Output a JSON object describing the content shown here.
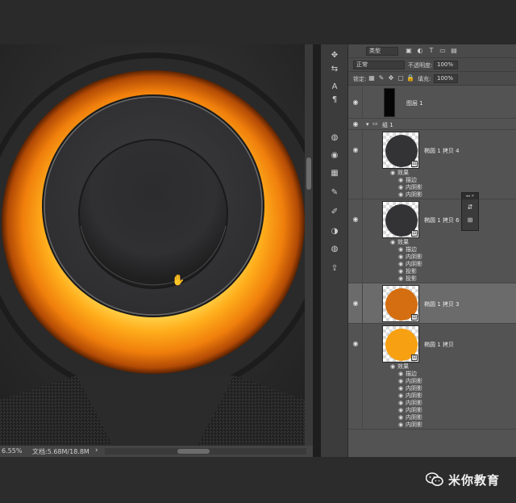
{
  "status": {
    "zoom": "6.55%",
    "doc": "文档:5.68M/18.8M",
    "arrow": "›"
  },
  "toolstrip": {
    "icons": [
      "move-icon",
      "adjust-icon",
      "type-icon",
      "paragraph-icon",
      "swatch-icon",
      "color-icon",
      "style-icon",
      "brush-icon",
      "clone-icon",
      "circle-half-icon",
      "mask-icon",
      "export-icon"
    ],
    "glyphs": [
      "✥",
      "⇆",
      "A",
      "¶",
      "◍",
      "◉",
      "▦",
      "✎",
      "✐",
      "◑",
      "◍",
      "⇪"
    ]
  },
  "options": {
    "kind_label": "类型",
    "blend_mode": "正常",
    "opacity_label": "不透明度:",
    "opacity_value": "100%",
    "lock_label": "锁定:",
    "fill_label": "填充:",
    "fill_value": "100%"
  },
  "layers": [
    {
      "name": "图层 1",
      "type": "black"
    },
    {
      "name": "组 1",
      "type": "group"
    },
    {
      "name": "椭圆 1 拷贝 4",
      "type": "disc",
      "color": "#333335",
      "effects": [
        "效果",
        "描边",
        "内阴影",
        "内阴影"
      ]
    },
    {
      "name": "椭圆 1 拷贝 6",
      "type": "disc",
      "color": "#333335",
      "effects": [
        "效果",
        "描边",
        "内阴影",
        "内阴影",
        "投影",
        "投影"
      ]
    },
    {
      "name": "椭圆 1 拷贝 3",
      "type": "disc",
      "color": "#d46e10",
      "selected": true,
      "effects": []
    },
    {
      "name": "椭圆 1 拷贝",
      "type": "disc",
      "color": "#f6a012",
      "effects": [
        "效果",
        "描边",
        "内阴影",
        "内阴影",
        "内阴影",
        "内阴影",
        "内阴影",
        "内阴影",
        "内阴影"
      ]
    }
  ],
  "watermark": {
    "text": "米你教育"
  },
  "colors": {
    "orange_outer": "#f08a10",
    "orange_inner": "#ffb020",
    "dark_disc": "#343436",
    "panel_bg": "#535353"
  }
}
